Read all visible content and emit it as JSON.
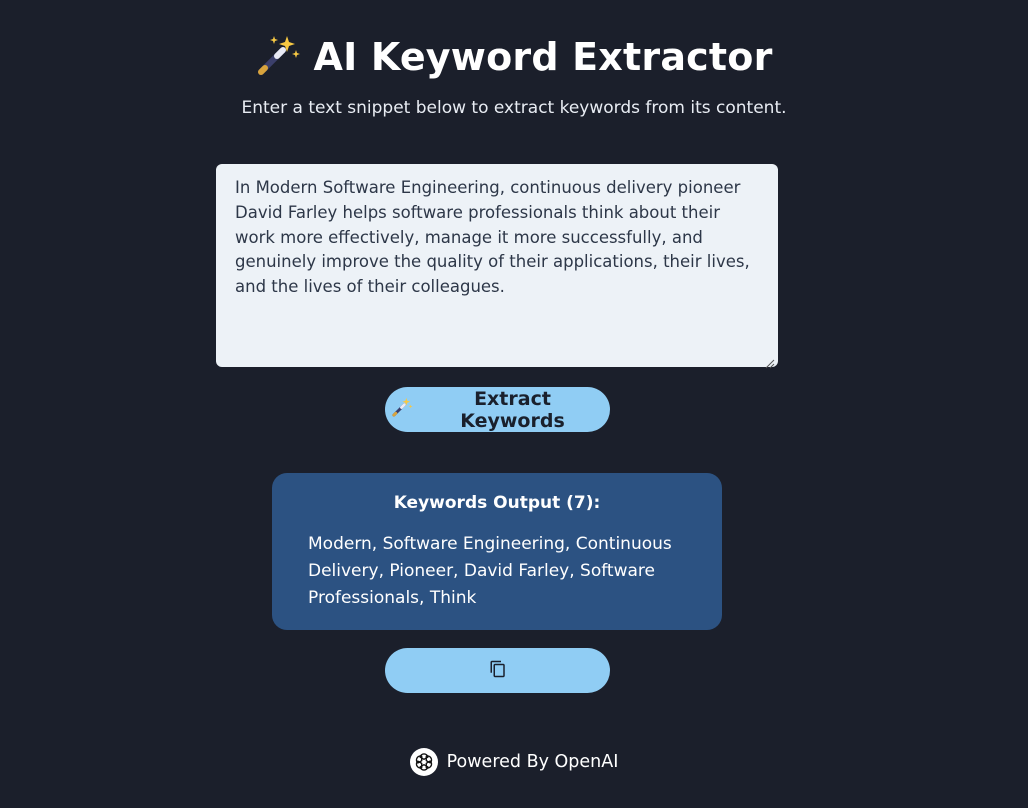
{
  "header": {
    "title": "AI Keyword Extractor",
    "title_icon": "magic-wand-icon",
    "subtitle": "Enter a text snippet below to extract keywords from its content."
  },
  "input": {
    "value": "In Modern Software Engineering, continuous delivery pioneer David Farley helps software professionals think about their work more effectively, manage it more successfully, and genuinely improve the quality of their applications, their lives, and the lives of their colleagues."
  },
  "extract_button": {
    "label": "Extract Keywords",
    "icon": "magic-wand-icon"
  },
  "output": {
    "heading": "Keywords Output (7):",
    "keywords": "Modern, Software Engineering, Continuous Delivery, Pioneer, David Farley, Software Professionals, Think"
  },
  "copy_button": {
    "icon": "copy-icon"
  },
  "footer": {
    "text": "Powered By OpenAI",
    "icon": "openai-logo-icon"
  },
  "colors": {
    "background": "#1b1f2b",
    "input_bg": "#edf2f7",
    "button_bg": "#90cdf4",
    "card_bg": "#2c5282"
  }
}
